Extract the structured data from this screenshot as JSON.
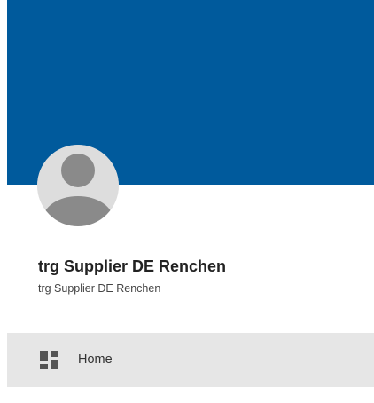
{
  "profile": {
    "name": "trg Supplier DE Renchen",
    "subtitle": "trg Supplier DE Renchen",
    "avatar_icon": "default-user-avatar-icon"
  },
  "colors": {
    "banner": "#005a9c",
    "nav_active_bg": "#e6e6e6",
    "avatar_bg": "#dddddd",
    "avatar_figure": "#8a8a8a"
  },
  "nav": {
    "items": [
      {
        "label": "Home",
        "icon": "dashboard-grid-icon",
        "active": true
      }
    ]
  }
}
